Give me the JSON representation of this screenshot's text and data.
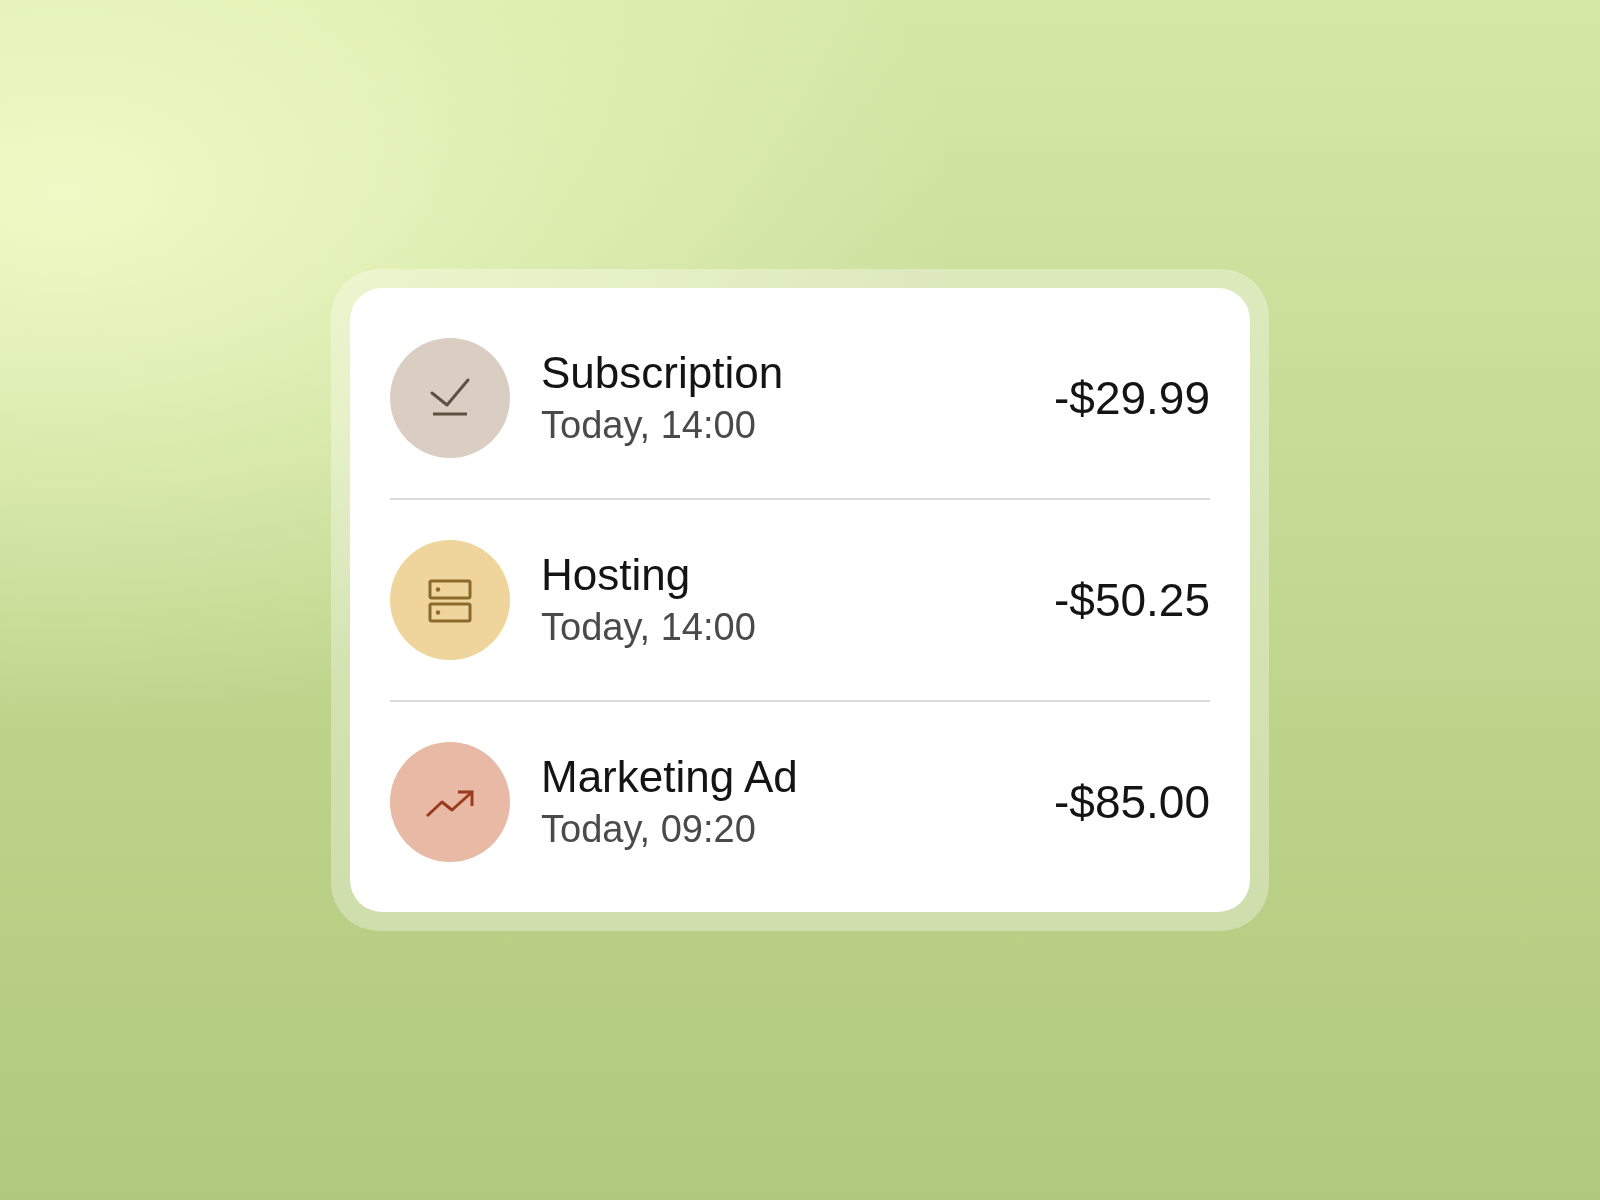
{
  "transactions": [
    {
      "kind": "tick",
      "color": "#d9cec1",
      "title": "Subscription",
      "time": "Today, 14:00",
      "amount": "-$29.99"
    },
    {
      "kind": "server",
      "color": "#efd59b",
      "title": "Hosting",
      "time": "Today, 14:00",
      "amount": "-$50.25"
    },
    {
      "kind": "trend",
      "color": "#e8b9a4",
      "title": "Marketing Ad",
      "time": "Today, 09:20",
      "amount": "-$85.00"
    }
  ]
}
